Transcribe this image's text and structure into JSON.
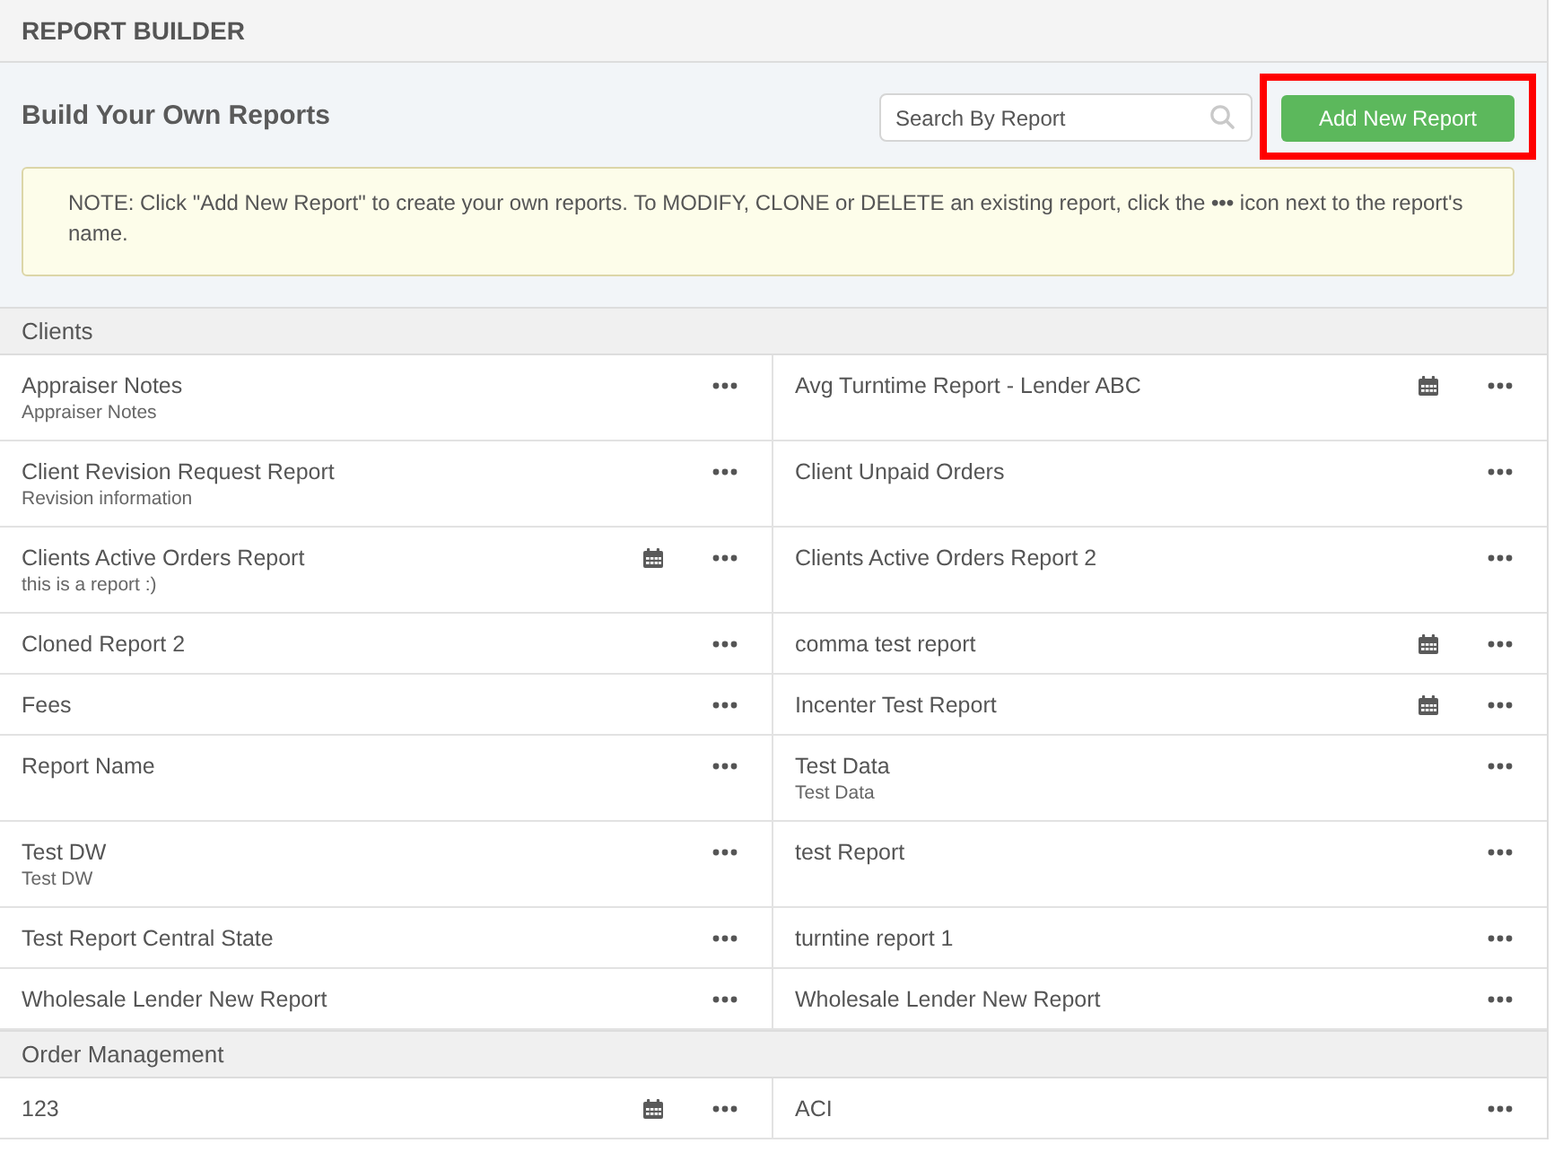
{
  "header": {
    "title": "REPORT BUILDER"
  },
  "toolbar": {
    "heading": "Build Your Own Reports",
    "search": {
      "placeholder": "Search By Report"
    },
    "add_button": {
      "label": "Add New Report",
      "highlighted": true
    }
  },
  "note": {
    "text": "NOTE: Click \"Add New Report\" to create your own reports. To MODIFY, CLONE or DELETE an existing report, click the **•••** icon next to the report's name."
  },
  "sections": [
    {
      "title": "Clients",
      "reports": [
        {
          "name": "Appraiser Notes",
          "description": "Appraiser Notes",
          "scheduled": false
        },
        {
          "name": "Avg Turntime Report - Lender ABC",
          "scheduled": true
        },
        {
          "name": "Client Revision Request Report",
          "description": "Revision information",
          "scheduled": false
        },
        {
          "name": "Client Unpaid Orders",
          "scheduled": false
        },
        {
          "name": "Clients Active Orders Report",
          "description": "this is a report :)",
          "scheduled": true
        },
        {
          "name": "Clients Active Orders Report 2",
          "scheduled": false
        },
        {
          "name": "Cloned Report 2",
          "scheduled": false
        },
        {
          "name": "comma test report",
          "scheduled": true
        },
        {
          "name": "Fees",
          "scheduled": false
        },
        {
          "name": "Incenter Test Report",
          "scheduled": true
        },
        {
          "name": "Report Name",
          "scheduled": false
        },
        {
          "name": "Test Data",
          "description": "Test Data",
          "scheduled": false
        },
        {
          "name": "Test DW",
          "description": "Test DW",
          "scheduled": false
        },
        {
          "name": "test Report",
          "scheduled": false
        },
        {
          "name": "Test Report Central State",
          "scheduled": false
        },
        {
          "name": "turntine report 1",
          "scheduled": false
        },
        {
          "name": "Wholesale Lender New Report",
          "scheduled": false
        },
        {
          "name": "Wholesale Lender New Report",
          "scheduled": false
        }
      ]
    },
    {
      "title": "Order Management",
      "reports": [
        {
          "name": "123",
          "scheduled": true
        },
        {
          "name": "ACI",
          "scheduled": false
        }
      ]
    }
  ]
}
